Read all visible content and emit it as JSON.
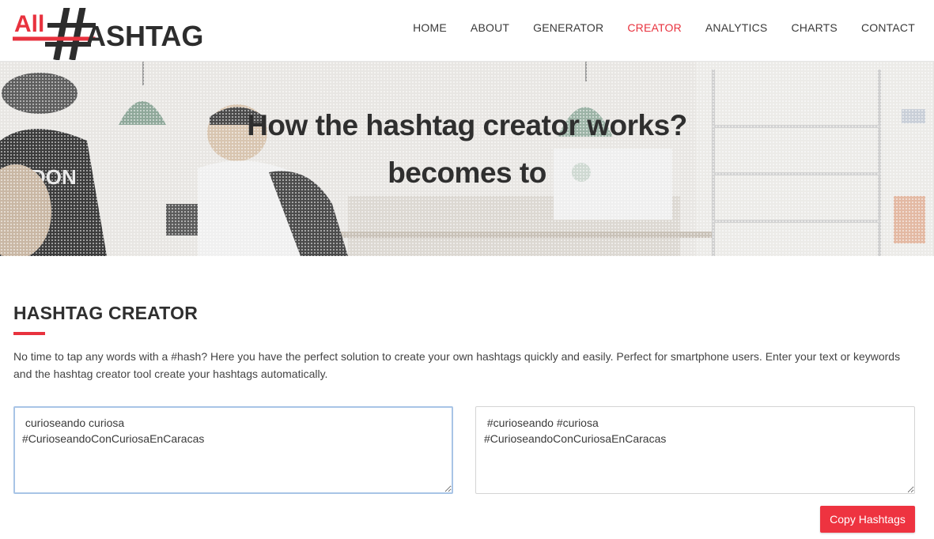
{
  "brand": {
    "logo_prefix": "All",
    "logo_symbol": "#",
    "logo_suffix": "ASHTAG",
    "accent_color": "#e8323e"
  },
  "nav": {
    "items": [
      {
        "label": "HOME"
      },
      {
        "label": "ABOUT"
      },
      {
        "label": "GENERATOR"
      },
      {
        "label": "CREATOR"
      },
      {
        "label": "ANALYTICS"
      },
      {
        "label": "CHARTS"
      },
      {
        "label": "CONTACT"
      }
    ],
    "active": "CREATOR"
  },
  "hero": {
    "line1": "How the hashtag creator works?",
    "line2": "becomes to"
  },
  "main": {
    "title": "HASHTAG CREATOR",
    "description": "No time to tap any words with a #hash? Here you have the perfect solution to create your own hashtags quickly and easily. Perfect for smartphone users. Enter your text or keywords and the hashtag creator tool create your hashtags automatically.",
    "input_value": " curioseando curiosa\n#CurioseandoConCuriosaEnCaracas",
    "output_value": " #curioseando #curiosa\n#CurioseandoConCuriosaEnCaracas",
    "copy_button_label": "Copy Hashtags"
  }
}
